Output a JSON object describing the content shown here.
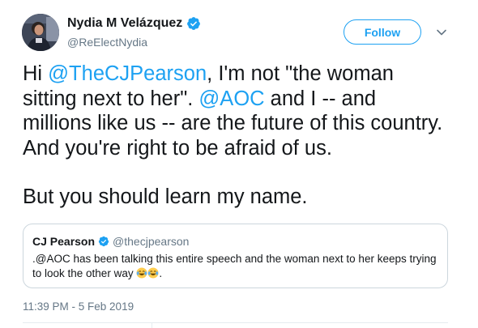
{
  "author": {
    "display_name": "Nydia M Velázquez",
    "handle": "@ReElectNydia",
    "verified": true
  },
  "follow_button": {
    "label": "Follow"
  },
  "tweet": {
    "segments": [
      {
        "text": "Hi ",
        "type": "text"
      },
      {
        "text": "@TheCJPearson",
        "type": "mention"
      },
      {
        "text": ", I'm not \"the woman sitting next to her\". ",
        "type": "text"
      },
      {
        "text": "@AOC",
        "type": "mention"
      },
      {
        "text": " and I -- and millions like us -- are the future of this country. And you're right to be afraid of us.",
        "type": "text"
      }
    ],
    "second_paragraph": "But you should learn my name."
  },
  "quoted_tweet": {
    "display_name": "CJ Pearson",
    "handle": "@thecjpearson",
    "verified": true,
    "text": ".@AOC has been talking this entire speech and the woman next to her keeps trying to look the other way",
    "trailing_emoji": [
      "face-with-tears-of-joy",
      "face-with-tears-of-joy"
    ],
    "trailing_punct": "."
  },
  "timestamp": "11:39 PM - 5 Feb 2019",
  "colors": {
    "accent": "#1da1f2",
    "text": "#14171a",
    "muted": "#657786",
    "border": "#ccd6dd"
  }
}
